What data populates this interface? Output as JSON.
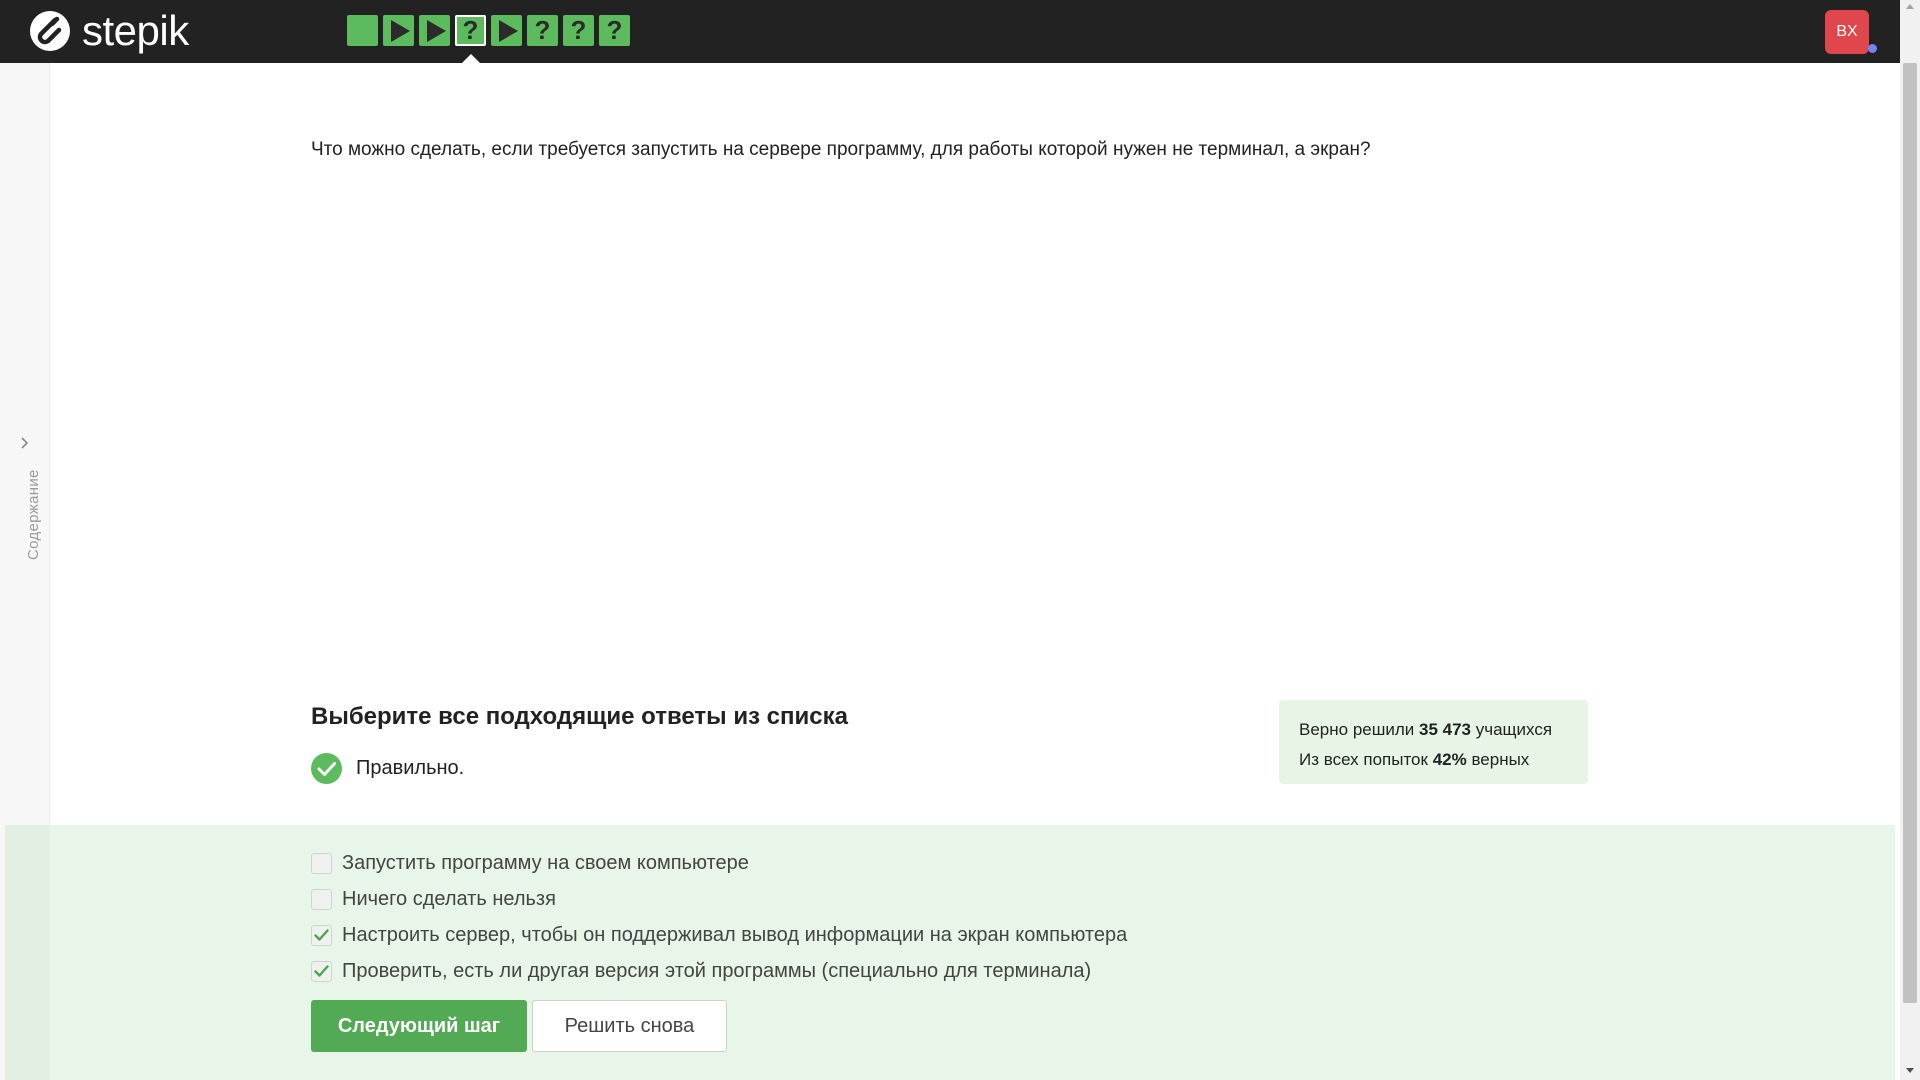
{
  "header": {
    "logo_text": "stepik",
    "steps": [
      {
        "kind": "text",
        "icon": "text-step-icon",
        "glyph": ""
      },
      {
        "kind": "video",
        "icon": "play-icon",
        "glyph": ""
      },
      {
        "kind": "video",
        "icon": "play-icon",
        "glyph": ""
      },
      {
        "kind": "quiz",
        "icon": "question-icon",
        "glyph": "?",
        "active": true
      },
      {
        "kind": "video",
        "icon": "play-icon",
        "glyph": ""
      },
      {
        "kind": "quiz",
        "icon": "question-icon",
        "glyph": "?"
      },
      {
        "kind": "quiz",
        "icon": "question-icon",
        "glyph": "?"
      },
      {
        "kind": "quiz",
        "icon": "question-icon",
        "glyph": "?"
      }
    ],
    "avatar_initials": "BX",
    "step_color": "#5cbb5c",
    "avatar_color": "#e0474c"
  },
  "sidebar": {
    "label": "Содержание"
  },
  "question": {
    "text": "Что можно сделать, если требуется запустить на сервере программу, для работы которой нужен не терминал, а экран?"
  },
  "quiz": {
    "title": "Выберите все подходящие ответы из списка",
    "verdict": "Правильно.",
    "options": [
      {
        "label": "Запустить программу на своем компьютере",
        "checked": false
      },
      {
        "label": "Ничего сделать нельзя",
        "checked": false
      },
      {
        "label": "Настроить сервер, чтобы он поддерживал вывод информации на экран компьютера",
        "checked": true
      },
      {
        "label": "Проверить, есть ли другая версия этой программы (специально для терминала)",
        "checked": true
      }
    ],
    "next_label": "Следующий шаг",
    "retry_label": "Решить снова",
    "accent_color": "#53aa55"
  },
  "stats": {
    "line1_prefix": "Верно решили",
    "solved_count": "35 473",
    "line1_suffix": "учащихся",
    "line2_prefix": "Из всех попыток",
    "percent": "42%",
    "line2_suffix": "верных"
  }
}
